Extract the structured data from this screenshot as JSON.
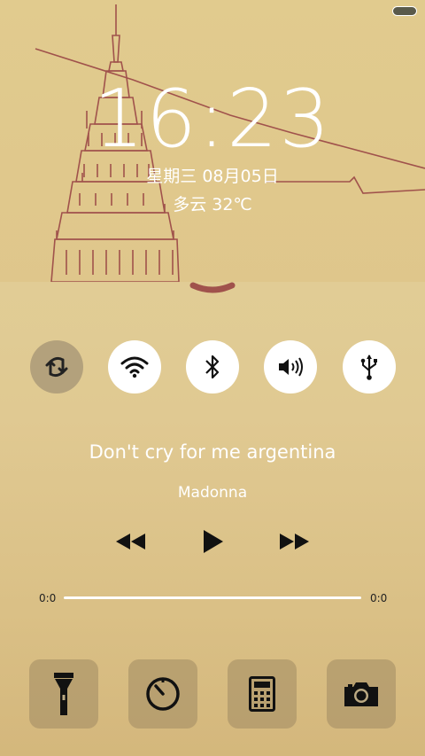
{
  "status": {
    "battery": "battery-icon"
  },
  "lockscreen": {
    "time": "16:23",
    "date": "星期三 08月05日",
    "weather": "多云 32℃"
  },
  "toggles": [
    {
      "name": "sync",
      "icon": "sync-icon",
      "state": "off"
    },
    {
      "name": "wifi",
      "icon": "wifi-icon",
      "state": "on"
    },
    {
      "name": "bluetooth",
      "icon": "bluetooth-icon",
      "state": "on"
    },
    {
      "name": "sound",
      "icon": "volume-icon",
      "state": "on"
    },
    {
      "name": "usb",
      "icon": "usb-icon",
      "state": "on"
    }
  ],
  "music": {
    "title": "Don't cry for me argentina",
    "artist": "Madonna",
    "elapsed": "0:0",
    "duration": "0:0",
    "progress": 0
  },
  "tools": [
    {
      "name": "flashlight",
      "icon": "flashlight-icon"
    },
    {
      "name": "timer",
      "icon": "timer-icon"
    },
    {
      "name": "calculator",
      "icon": "calculator-icon"
    },
    {
      "name": "camera",
      "icon": "camera-icon"
    }
  ],
  "colors": {
    "accent": "#a0524c",
    "text": "#ffffff",
    "toggle_off": "#b3a17c"
  }
}
